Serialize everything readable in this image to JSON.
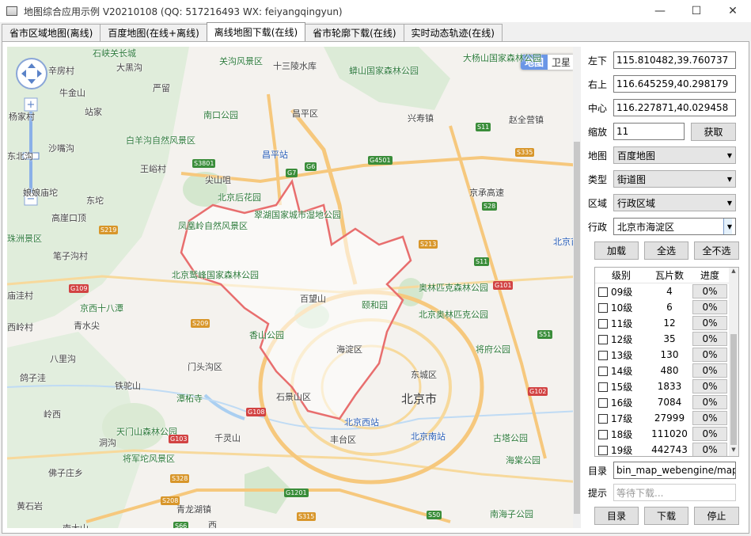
{
  "window": {
    "title": "地图综合应用示例 V20210108 (QQ: 517216493 WX: feiyangqingyun)",
    "minimize": "—",
    "maximize": "☐",
    "close": "✕"
  },
  "tabs": [
    {
      "label": "省市区域地图(离线)"
    },
    {
      "label": "百度地图(在线+离线)"
    },
    {
      "label": "离线地图下载(在线)"
    },
    {
      "label": "省市轮廓下载(在线)"
    },
    {
      "label": "实时动态轨迹(在线)"
    }
  ],
  "map": {
    "type_map": "地图",
    "type_satellite": "卫星",
    "labels": [
      {
        "text": "石峡关长城",
        "cls": "green"
      },
      {
        "text": "大黑沟",
        "cls": ""
      },
      {
        "text": "关沟风景区",
        "cls": "green"
      },
      {
        "text": "十三陵水库",
        "cls": ""
      },
      {
        "text": "蟒山国家森林公园",
        "cls": "green"
      },
      {
        "text": "大杨山国家森林公园",
        "cls": "green"
      },
      {
        "text": "辛房村",
        "cls": ""
      },
      {
        "text": "牛金山",
        "cls": ""
      },
      {
        "text": "严留",
        "cls": ""
      },
      {
        "text": "站家",
        "cls": ""
      },
      {
        "text": "南口公园",
        "cls": "green"
      },
      {
        "text": "昌平区",
        "cls": ""
      },
      {
        "text": "兴寿镇",
        "cls": ""
      },
      {
        "text": "赵全营镇",
        "cls": ""
      },
      {
        "text": "杨家村",
        "cls": ""
      },
      {
        "text": "白羊沟自然风景区",
        "cls": "green"
      },
      {
        "text": "沙嘴沟",
        "cls": ""
      },
      {
        "text": "东北沟",
        "cls": ""
      },
      {
        "text": "王峪村",
        "cls": ""
      },
      {
        "text": "昌平站",
        "cls": "blue"
      },
      {
        "text": "尖山咀",
        "cls": ""
      },
      {
        "text": "北京后花园",
        "cls": "green"
      },
      {
        "text": "娘娘庙坨",
        "cls": ""
      },
      {
        "text": "东坨",
        "cls": ""
      },
      {
        "text": "翠湖国家城市湿地公园",
        "cls": "green"
      },
      {
        "text": "京承高速",
        "cls": ""
      },
      {
        "text": "高崖口顶",
        "cls": ""
      },
      {
        "text": "凤凰岭自然风景区",
        "cls": "green"
      },
      {
        "text": "珠洲景区",
        "cls": "green"
      },
      {
        "text": "笔子沟村",
        "cls": ""
      },
      {
        "text": "北京首都国际",
        "cls": "blue"
      },
      {
        "text": "北京鹫峰国家森林公园",
        "cls": "green"
      },
      {
        "text": "奥林匹克森林公园",
        "cls": "green"
      },
      {
        "text": "百望山",
        "cls": ""
      },
      {
        "text": "庙洼村",
        "cls": ""
      },
      {
        "text": "京西十八潭",
        "cls": "green"
      },
      {
        "text": "颐和园",
        "cls": "green"
      },
      {
        "text": "北京奥林匹克公园",
        "cls": "green"
      },
      {
        "text": "西岭村",
        "cls": ""
      },
      {
        "text": "青水尖",
        "cls": ""
      },
      {
        "text": "香山公园",
        "cls": "green"
      },
      {
        "text": "海淀区",
        "cls": ""
      },
      {
        "text": "将府公园",
        "cls": "green"
      },
      {
        "text": "八里沟",
        "cls": ""
      },
      {
        "text": "门头沟区",
        "cls": ""
      },
      {
        "text": "东城区",
        "cls": ""
      },
      {
        "text": "鸽子洼",
        "cls": ""
      },
      {
        "text": "铁驼山",
        "cls": ""
      },
      {
        "text": "北京市",
        "cls": "big"
      },
      {
        "text": "潭柘寺",
        "cls": "green"
      },
      {
        "text": "石景山区",
        "cls": ""
      },
      {
        "text": "岭西",
        "cls": ""
      },
      {
        "text": "北京西站",
        "cls": "blue"
      },
      {
        "text": "天门山森林公园",
        "cls": "green"
      },
      {
        "text": "千灵山",
        "cls": ""
      },
      {
        "text": "丰台区",
        "cls": ""
      },
      {
        "text": "北京南站",
        "cls": "blue"
      },
      {
        "text": "古塔公园",
        "cls": "green"
      },
      {
        "text": "洞沟",
        "cls": ""
      },
      {
        "text": "将军坨风景区",
        "cls": "green"
      },
      {
        "text": "海棠公园",
        "cls": "green"
      },
      {
        "text": "佛子庄乡",
        "cls": ""
      },
      {
        "text": "黄石岩",
        "cls": ""
      },
      {
        "text": "青龙湖镇",
        "cls": ""
      },
      {
        "text": "南海子公园",
        "cls": "green"
      },
      {
        "text": "南大山",
        "cls": ""
      },
      {
        "text": "西",
        "cls": ""
      }
    ],
    "road_signs": [
      {
        "text": "S3801",
        "cls": "green"
      },
      {
        "text": "G7",
        "cls": "green"
      },
      {
        "text": "G6",
        "cls": "green"
      },
      {
        "text": "G4501",
        "cls": "green"
      },
      {
        "text": "S11",
        "cls": "green"
      },
      {
        "text": "S335",
        "cls": "orange"
      },
      {
        "text": "S28",
        "cls": "green"
      },
      {
        "text": "S213",
        "cls": "orange"
      },
      {
        "text": "S219",
        "cls": "orange"
      },
      {
        "text": "S11",
        "cls": "green"
      },
      {
        "text": "G101",
        "cls": "red"
      },
      {
        "text": "G109",
        "cls": "red"
      },
      {
        "text": "S209",
        "cls": "orange"
      },
      {
        "text": "S51",
        "cls": "green"
      },
      {
        "text": "G102",
        "cls": "red"
      },
      {
        "text": "G108",
        "cls": "red"
      },
      {
        "text": "G103",
        "cls": "red"
      },
      {
        "text": "S328",
        "cls": "orange"
      },
      {
        "text": "S208",
        "cls": "orange"
      },
      {
        "text": "G1201",
        "cls": "green"
      },
      {
        "text": "S66",
        "cls": "green"
      },
      {
        "text": "S315",
        "cls": "orange"
      },
      {
        "text": "S50",
        "cls": "green"
      }
    ]
  },
  "panel": {
    "top_left_label": "左下",
    "top_left_value": "115.810482,39.760737",
    "top_right_label": "右上",
    "top_right_value": "116.645259,40.298179",
    "center_label": "中心",
    "center_value": "116.227871,40.029458",
    "zoom_label": "缩放",
    "zoom_value": "11",
    "fetch_button": "获取",
    "map_label": "地图",
    "map_value": "百度地图",
    "type_label": "类型",
    "type_value": "街道图",
    "region_label": "区域",
    "region_value": "行政区域",
    "admin_label": "行政",
    "admin_value": "北京市海淀区",
    "load_button": "加载",
    "select_all_button": "全选",
    "select_none_button": "全不选",
    "table_headers": {
      "level": "级别",
      "tiles": "瓦片数",
      "progress": "进度"
    },
    "levels": [
      {
        "level": "09级",
        "tiles": "4",
        "progress": "0%"
      },
      {
        "level": "10级",
        "tiles": "6",
        "progress": "0%"
      },
      {
        "level": "11级",
        "tiles": "12",
        "progress": "0%"
      },
      {
        "level": "12级",
        "tiles": "35",
        "progress": "0%"
      },
      {
        "level": "13级",
        "tiles": "130",
        "progress": "0%"
      },
      {
        "level": "14级",
        "tiles": "480",
        "progress": "0%"
      },
      {
        "level": "15级",
        "tiles": "1833",
        "progress": "0%"
      },
      {
        "level": "16级",
        "tiles": "7084",
        "progress": "0%"
      },
      {
        "level": "17级",
        "tiles": "27999",
        "progress": "0%"
      },
      {
        "level": "18级",
        "tiles": "111020",
        "progress": "0%"
      },
      {
        "level": "19级",
        "tiles": "442743",
        "progress": "0%"
      }
    ],
    "dir_label": "目录",
    "dir_value": "bin_map_webengine/map",
    "hint_label": "提示",
    "hint_placeholder": "等待下载...",
    "dir_button": "目录",
    "download_button": "下载",
    "stop_button": "停止"
  }
}
